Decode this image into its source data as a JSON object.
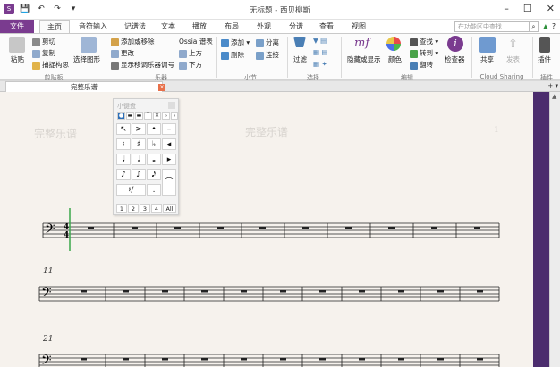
{
  "window": {
    "title": "无标题 - 西贝柳斯"
  },
  "tabs": [
    "文件",
    "主页",
    "音符输入",
    "记谱法",
    "文本",
    "播放",
    "布局",
    "外观",
    "分谱",
    "查看",
    "视图"
  ],
  "search": {
    "placeholder": "在功能区中查找"
  },
  "ribbon": {
    "clipboard": {
      "paste": "粘贴",
      "cut": "剪切",
      "copy": "复制",
      "capture": "捕捉构思",
      "select_graphic": "选择图形",
      "label": "剪贴板"
    },
    "instruments": {
      "add_remove": "添加或移除",
      "change": "更改",
      "show_transpose": "显示移调乐器调号",
      "ossia": "Ossia 谱表",
      "above": "上方",
      "below": "下方",
      "label": "乐器"
    },
    "bars": {
      "add": "添加",
      "split": "分离",
      "delete": "删除",
      "join": "连接",
      "label": "小节"
    },
    "selection": {
      "filter": "过滤",
      "label": "选择"
    },
    "edit": {
      "hide_show": "隐藏或显示",
      "color": "颜色",
      "find": "查找",
      "goto": "转到",
      "flip": "翻转",
      "inspector": "检查器",
      "label": "编辑"
    },
    "cloud": {
      "share": "共享",
      "publish": "发表",
      "label": "Cloud Sharing"
    },
    "plugins": {
      "plugin": "插件",
      "label": "插件"
    }
  },
  "document": {
    "tab": "完整乐谱",
    "ghost_left": "完整乐谱",
    "ghost_center": "完整乐谱",
    "page_number": "1"
  },
  "score": {
    "bar_numbers": [
      "11",
      "21"
    ]
  },
  "palette": {
    "title": "小键盘",
    "tabs": [
      "1",
      "2",
      "3",
      "4",
      "All"
    ],
    "rows": [
      [
        "↖",
        ">",
        "•",
        "–"
      ],
      [
        "♮",
        "♯",
        "♭",
        "◂"
      ],
      [
        "𝅘𝅥",
        "𝅗𝅥",
        "𝅝",
        "▸"
      ],
      [
        "♪",
        "♪",
        "𝅘𝅥𝅯",
        "⌒"
      ],
      [
        "𝄽/",
        ".",
        "",
        " "
      ]
    ]
  }
}
